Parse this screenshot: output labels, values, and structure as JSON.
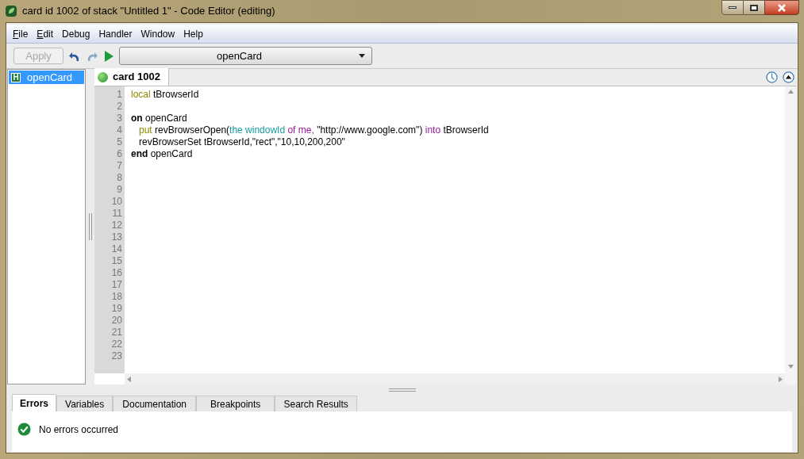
{
  "window": {
    "title": "card id 1002 of stack \"Untitled 1\" - Code Editor (editing)"
  },
  "menu": [
    {
      "label": "File",
      "mnemonic": true
    },
    {
      "label": "Edit",
      "mnemonic": true
    },
    {
      "label": "Debug",
      "mnemonic": false
    },
    {
      "label": "Handler",
      "mnemonic": false
    },
    {
      "label": "Window",
      "mnemonic": false
    },
    {
      "label": "Help",
      "mnemonic": false
    }
  ],
  "toolbar": {
    "apply": {
      "label": "Apply",
      "disabled": true
    },
    "redo_disabled": true,
    "handler_dropdown": "openCard"
  },
  "handlers": [
    {
      "badge": "H",
      "label": "openCard",
      "selected": true
    }
  ],
  "editor_tabs": [
    {
      "label": "card 1002",
      "selected": true
    }
  ],
  "code": {
    "lines": [
      {
        "number": "1",
        "tokens": [
          {
            "kind": "command",
            "text": "local"
          },
          {
            "kind": "plain",
            "text": " tBrowserId"
          }
        ]
      },
      {
        "number": "2"
      },
      {
        "number": "3",
        "tokens": [
          {
            "kind": "control",
            "text": "on"
          },
          {
            "kind": "plain",
            "text": " openCard"
          }
        ]
      },
      {
        "number": "4",
        "indent": true,
        "tokens": [
          {
            "kind": "command",
            "text": "put"
          },
          {
            "kind": "plain",
            "text": " revBrowserOpen("
          },
          {
            "kind": "property",
            "text": "the windowId"
          },
          {
            "kind": "operator",
            "text": " of me,"
          },
          {
            "kind": "plain",
            "text": " \"http://www.google.com\")"
          },
          {
            "kind": "operator",
            "text": " into"
          },
          {
            "kind": "plain",
            "text": " tBrowserId"
          }
        ]
      },
      {
        "number": "5",
        "indent": true,
        "tokens": [
          {
            "kind": "plain",
            "text": "revBrowserSet tBrowserId,\"rect\",\"10,10,200,200\""
          }
        ]
      },
      {
        "number": "6",
        "tokens": [
          {
            "kind": "control",
            "text": "end"
          },
          {
            "kind": "plain",
            "text": " openCard"
          }
        ]
      },
      {
        "number": "7"
      },
      {
        "number": "8"
      },
      {
        "number": "9"
      },
      {
        "number": "10"
      },
      {
        "number": "11"
      },
      {
        "number": "12"
      },
      {
        "number": "13"
      },
      {
        "number": "14"
      },
      {
        "number": "15"
      },
      {
        "number": "16"
      },
      {
        "number": "17"
      },
      {
        "number": "18"
      },
      {
        "number": "19"
      },
      {
        "number": "20"
      },
      {
        "number": "21"
      },
      {
        "number": "22"
      },
      {
        "number": "23"
      }
    ]
  },
  "bottom_tabs": [
    {
      "label": "Errors",
      "selected": true
    },
    {
      "label": "Variables",
      "selected": false
    },
    {
      "label": "Documentation",
      "selected": false
    },
    {
      "label": "Breakpoints",
      "selected": false
    },
    {
      "label": "Search Results",
      "selected": false
    }
  ],
  "status": {
    "kind": "ok",
    "message": "No errors occurred"
  }
}
